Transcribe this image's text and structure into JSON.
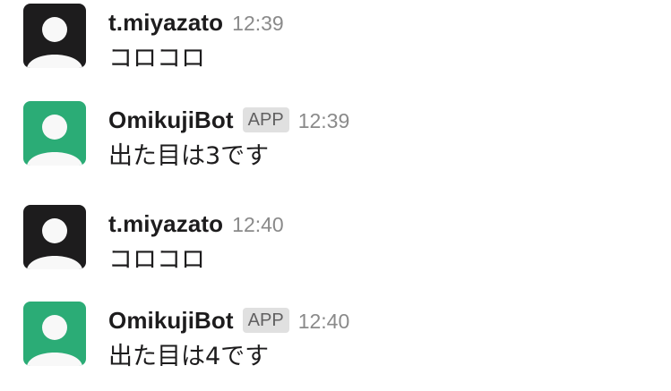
{
  "messages": [
    {
      "sender": "t.miyazato",
      "badge": "",
      "time": "12:39",
      "text": "コロコロ",
      "avatar_color": "#1d1c1d",
      "avatar_icon": "person-icon"
    },
    {
      "sender": "OmikujiBot",
      "badge": "APP",
      "time": "12:39",
      "text": "出た目は3です",
      "avatar_color": "#2bac76",
      "avatar_icon": "person-icon"
    },
    {
      "sender": "t.miyazato",
      "badge": "",
      "time": "12:40",
      "text": "コロコロ",
      "avatar_color": "#1d1c1d",
      "avatar_icon": "person-icon"
    },
    {
      "sender": "OmikujiBot",
      "badge": "APP",
      "time": "12:40",
      "text": "出た目は4です",
      "avatar_color": "#2bac76",
      "avatar_icon": "person-icon"
    }
  ]
}
